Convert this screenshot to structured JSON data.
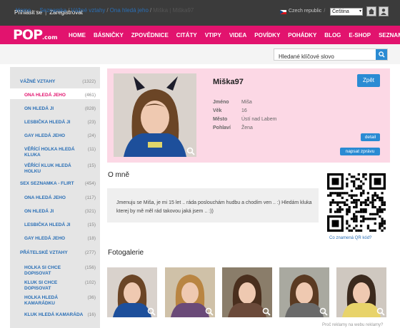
{
  "topbar": {
    "login": "Přihlásit se",
    "separator": "|",
    "register": "Zaregistrovat",
    "region": "Czech republic",
    "region_sep": "/",
    "language": "Čeština"
  },
  "nav": {
    "logo_main": "POP",
    "logo_suffix": ".com",
    "items": [
      "HOME",
      "BÁSNIČKY",
      "ZPOVĚDNICE",
      "CITÁTY",
      "VTIPY",
      "VIDEA",
      "POVÍDKY",
      "POHÁDKY",
      "BLOG",
      "E-SHOP",
      "SEZNAMKA"
    ]
  },
  "breadcrumb": {
    "home": "Home",
    "arrow": "→",
    "seznamka": "Seznamka",
    "slash": "/",
    "vazne": "Vážné vztahy",
    "ona": "Ona hledá jeho",
    "current": "Miška | Miška97"
  },
  "search": {
    "placeholder": "Hledané klíčové slovo"
  },
  "sidebar": [
    {
      "label": "VÁŽNÉ VZTAHY",
      "count": "(1322)"
    },
    {
      "label": "ONA HLEDÁ JEHO",
      "count": "(461)"
    },
    {
      "label": "ON HLEDÁ JI",
      "count": "(828)"
    },
    {
      "label": "LESBIČKA HLEDÁ JI",
      "count": "(23)"
    },
    {
      "label": "GAY HLEDÁ JEHO",
      "count": "(24)"
    },
    {
      "label": "VĚŘÍCÍ HOLKA HLEDÁ KLUKA",
      "count": "(11)"
    },
    {
      "label": "VĚŘÍCÍ KLUK HLEDÁ HOLKU",
      "count": "(15)"
    },
    {
      "label": "SEX SEZNAMKA - FLIRT",
      "count": "(454)"
    },
    {
      "label": "ONA HLEDÁ JEHO",
      "count": "(117)"
    },
    {
      "label": "ON HLEDÁ JI",
      "count": "(321)"
    },
    {
      "label": "LESBIČKA HLEDÁ JI",
      "count": "(15)"
    },
    {
      "label": "GAY HLEDÁ JEHO",
      "count": "(18)"
    },
    {
      "label": "PŘÁTELSKÉ VZTAHY",
      "count": "(277)"
    },
    {
      "label": "HOLKA SI CHCE DOPISOVAT",
      "count": "(156)"
    },
    {
      "label": "KLUK SI CHCE DOPISOVAT",
      "count": "(102)"
    },
    {
      "label": "HOLKA HLEDÁ KAMARÁDKU",
      "count": "(36)"
    },
    {
      "label": "KLUK HLEDÁ KAMARÁDA",
      "count": "(16)"
    }
  ],
  "profile": {
    "name": "Miška97",
    "fields": [
      {
        "key": "Jméno",
        "value": "Miša"
      },
      {
        "key": "Věk",
        "value": "16"
      },
      {
        "key": "Město",
        "value": "Ústí nad Labem"
      },
      {
        "key": "Pohlaví",
        "value": "Žena"
      }
    ],
    "back_label": "Zpět",
    "detail_label": "detail",
    "message_label": "napsat zprávu"
  },
  "about": {
    "heading": "O mně",
    "text": "Jmenuju se Miša, je mi 15 let .. ráda poslouchám hudbu a chodím ven .. :) Hledám kluka kterej by mě měl rád takovou jaká jsem .. :))"
  },
  "qr": {
    "link": "Co znamená QR kód?"
  },
  "gallery": {
    "heading": "Fotogalerie"
  },
  "ad": {
    "link": "Proč reklamy na webu reklamy?"
  },
  "colors": {
    "accent": "#e2136e",
    "link": "#2a6fb6",
    "button": "#2a8bd3",
    "profile_bg": "#fcd8e5"
  }
}
